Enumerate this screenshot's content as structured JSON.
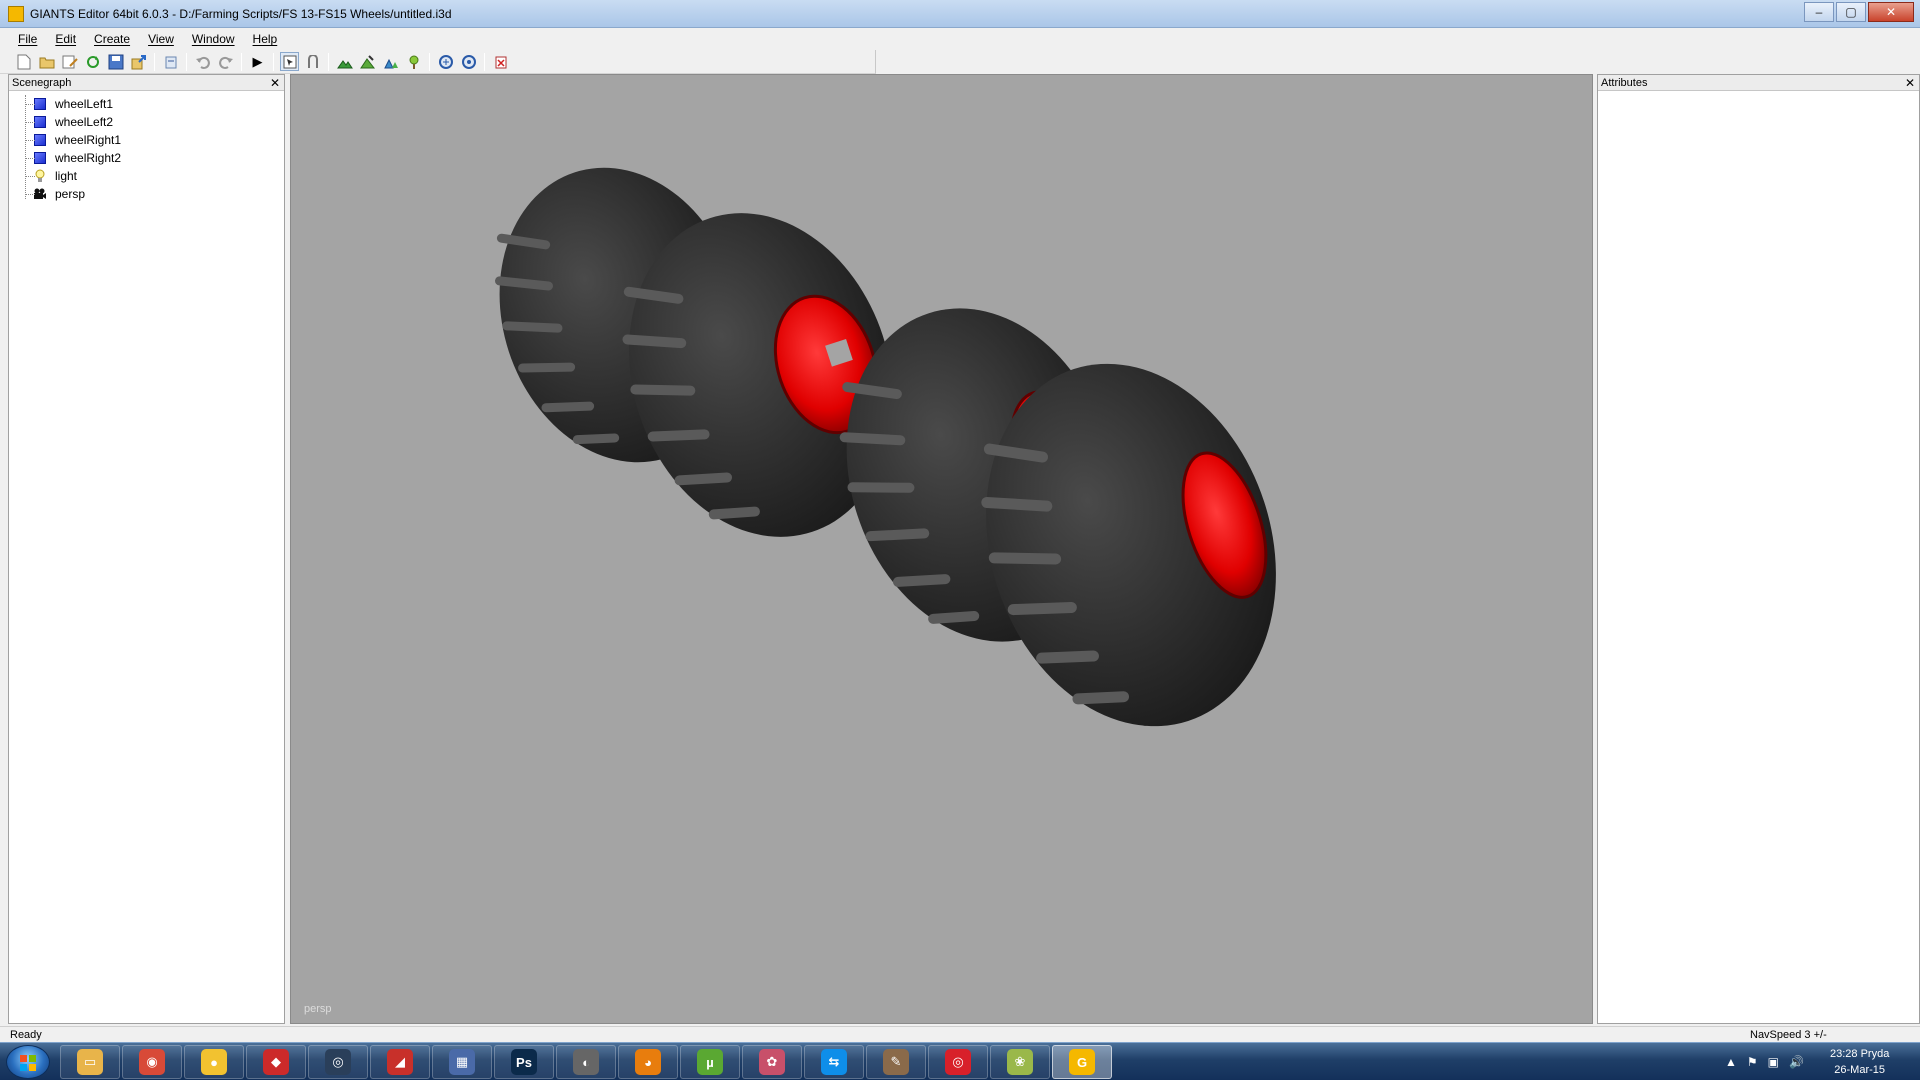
{
  "window": {
    "title": "GIANTS Editor 64bit 6.0.3 - D:/Farming Scripts/FS 13-FS15 Wheels/untitled.i3d",
    "minimize": "–",
    "maximize": "▢",
    "close": "✕"
  },
  "menu": {
    "items": [
      "File",
      "Edit",
      "Create",
      "View",
      "Window",
      "Help"
    ]
  },
  "toolbar": {
    "icons": [
      "new-file-icon",
      "open-file-icon",
      "edit-icon",
      "refresh-icon",
      "save-icon",
      "export-icon",
      "revert-icon",
      "undo-icon",
      "redo-icon",
      "play-icon",
      "select-mode-icon",
      "move-mode-icon",
      "terrain-paint-icon",
      "terrain-sculpt-icon",
      "foliage-paint-icon",
      "foliage-erase-icon",
      "sync-icon",
      "settings-sync-icon",
      "delete-icon"
    ],
    "play_glyph": "▶"
  },
  "scenegraph": {
    "title": "Scenegraph",
    "close": "✕",
    "nodes": [
      {
        "label": "wheelLeft1",
        "icon": "cube-icon"
      },
      {
        "label": "wheelLeft2",
        "icon": "cube-icon"
      },
      {
        "label": "wheelRight1",
        "icon": "cube-icon"
      },
      {
        "label": "wheelRight2",
        "icon": "cube-icon"
      },
      {
        "label": "light",
        "icon": "light-bulb-icon"
      },
      {
        "label": "persp",
        "icon": "camera-icon"
      }
    ],
    "light_glyph": "💡",
    "camera_glyph": "🎥"
  },
  "viewport": {
    "camera": "persp",
    "background": "#a4a4a4",
    "rim_color": "#e00000",
    "tire_color": "#2a2a2a"
  },
  "attributes": {
    "title": "Attributes",
    "close": "✕"
  },
  "status": {
    "left": "Ready",
    "right": "NavSpeed 3 +/-"
  },
  "taskbar": {
    "apps": [
      {
        "name": "explorer-icon",
        "color": "#e8b44a",
        "glyph": "▭"
      },
      {
        "name": "chrome-icon",
        "color": "#d84a38",
        "glyph": "◉"
      },
      {
        "name": "media-player-icon",
        "color": "#f2c230",
        "glyph": "●"
      },
      {
        "name": "app-red-icon",
        "color": "#cc2a2a",
        "glyph": "◆"
      },
      {
        "name": "steam-icon",
        "color": "#2a3f5a",
        "glyph": "◎"
      },
      {
        "name": "sketchup-icon",
        "color": "#c8302a",
        "glyph": "◢"
      },
      {
        "name": "paint-icon",
        "color": "#4a6aa8",
        "glyph": "▦"
      },
      {
        "name": "photoshop-icon",
        "color": "#0b2a4a",
        "glyph": "Ps"
      },
      {
        "name": "app-gray-icon",
        "color": "#666666",
        "glyph": "◐"
      },
      {
        "name": "blender-icon",
        "color": "#e87d0d",
        "glyph": "◕"
      },
      {
        "name": "utorrent-icon",
        "color": "#5aa832",
        "glyph": "µ"
      },
      {
        "name": "app-pink-icon",
        "color": "#c8506a",
        "glyph": "✿"
      },
      {
        "name": "teamviewer-icon",
        "color": "#0e8ee9",
        "glyph": "⇆"
      },
      {
        "name": "app-tool-icon",
        "color": "#8a6a4a",
        "glyph": "✎"
      },
      {
        "name": "app-target-icon",
        "color": "#d8202a",
        "glyph": "◎"
      },
      {
        "name": "app-fruit-icon",
        "color": "#9ab84a",
        "glyph": "❀"
      },
      {
        "name": "giants-editor-icon",
        "color": "#f5b800",
        "glyph": "G"
      }
    ],
    "tray": {
      "expand": "▲",
      "flag": "⚑",
      "network": "▣",
      "volume": "🔊"
    },
    "clock_time": "23:28 Pryda",
    "clock_date": "26-Mar-15"
  }
}
